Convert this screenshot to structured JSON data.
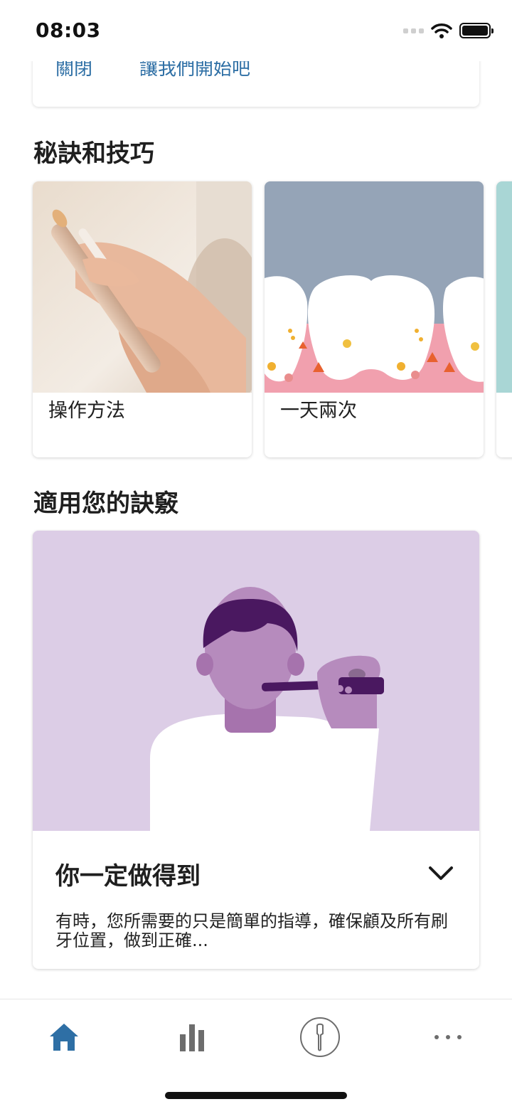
{
  "status_bar": {
    "time": "08:03"
  },
  "top_card": {
    "close_label": "關閉",
    "start_label": "讓我們開始吧"
  },
  "tips_section": {
    "title": "秘訣和技巧",
    "cards": [
      {
        "label": "操作方法"
      },
      {
        "label": "一天兩次"
      }
    ]
  },
  "yours_section": {
    "title": "適用您的訣竅",
    "card": {
      "title": "你一定做得到",
      "description": "有時，您所需要的只是簡單的指導，確保顧及所有刷牙位置，做到正確..."
    }
  },
  "tab_bar": {
    "items": [
      {
        "icon": "home-icon",
        "selected": true
      },
      {
        "icon": "bar-chart-icon",
        "selected": false
      },
      {
        "icon": "brush-head-icon",
        "selected": false
      },
      {
        "icon": "more-icon",
        "selected": false
      }
    ]
  },
  "colors": {
    "accent": "#2e6fa5",
    "hero_bg": "#dccde6",
    "tooth_bg": "#95a4b7",
    "gum": "#f1a0ae"
  }
}
